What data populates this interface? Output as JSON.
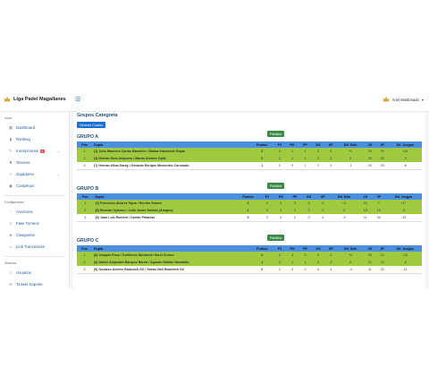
{
  "brand": {
    "name": "Liga Padel Magallanes"
  },
  "user": {
    "name": "Ariel Maldonado"
  },
  "sidebar": {
    "sections": [
      {
        "title": "Inicio",
        "items": [
          {
            "label": "Dashboard",
            "icon": "dashboard-icon"
          },
          {
            "label": "Ranking",
            "icon": "ranking-icon"
          },
          {
            "label": "Inscripciones",
            "icon": "inscriptions-icon",
            "badge": "4",
            "expand": true
          },
          {
            "label": "Torneos",
            "icon": "trophy-icon"
          },
          {
            "label": "Jugadores",
            "icon": "users-icon",
            "expand": true
          },
          {
            "label": "Complejos",
            "icon": "building-icon"
          }
        ]
      },
      {
        "title": "Configuración",
        "items": [
          {
            "label": "Ascensos",
            "icon": "arrow-up-icon"
          },
          {
            "label": "Fase Torneos",
            "icon": "phases-icon"
          },
          {
            "label": "Categorias",
            "icon": "tags-icon"
          },
          {
            "label": "Link Transmisión",
            "icon": "link-icon"
          }
        ]
      },
      {
        "title": "Sistema",
        "items": [
          {
            "label": "Usuarios",
            "icon": "user-icon"
          },
          {
            "label": "Tickets Soporte",
            "icon": "ticket-icon"
          }
        ]
      }
    ]
  },
  "page": {
    "title": "Grupos Categoria",
    "generate_button": "Generar Cuadro"
  },
  "table_headers": [
    "Pos",
    "Dupla",
    "Puntos",
    "PJ",
    "PG",
    "PP",
    "SG",
    "SP",
    "Dif. Sets",
    "JG",
    "JP",
    "Dif. Juegos"
  ],
  "groups": [
    {
      "name": "GRUPO A",
      "button": "Partidos",
      "rows": [
        {
          "pos": "1",
          "dupla": "(1) John Mauricio Carlos Manolich / Matias Kambonic Rojas",
          "puntos": "3",
          "pj": "2",
          "pg": "1",
          "pp": "1",
          "sg": "3",
          "sp": "2",
          "ds": "+1",
          "jg": "29",
          "jp": "19",
          "dj": "+10",
          "qualified": true
        },
        {
          "pos": "2",
          "dupla": "(4) Hernan Soto Ampuero / Martin Alvarez Opitz",
          "puntos": "3",
          "pj": "2",
          "pg": "1",
          "pp": "1",
          "sg": "3",
          "sp": "3",
          "ds": "0",
          "jg": "23",
          "jp": "25",
          "dj": "-2",
          "qualified": true
        },
        {
          "pos": "3",
          "dupla": "(7) Hernan Ulloa Garay / Gerardo Enrique Menendez Coronado",
          "puntos": "1",
          "pj": "2",
          "pg": "0",
          "pp": "1",
          "sg": "2",
          "sp": "3",
          "ds": "-1",
          "jg": "23",
          "jp": "29",
          "dj": "-6",
          "qualified": false
        }
      ]
    },
    {
      "name": "GRUPO B",
      "button": "Partidos",
      "rows": [
        {
          "pos": "1",
          "dupla": "(2) Francisco Alvarez Tapia / Hernán Gomez",
          "puntos": "2",
          "pj": "2",
          "pg": "2",
          "pp": "0",
          "sg": "4",
          "sp": "0",
          "ds": "+4",
          "jg": "24",
          "jp": "7",
          "dj": "+17",
          "qualified": true
        },
        {
          "pos": "2",
          "dupla": "(8) Ricardo Oyarzun / Julio Javier Salinas (Amigos)",
          "puntos": "1",
          "pj": "2",
          "pg": "1",
          "pp": "1",
          "sg": "2",
          "sp": "2",
          "ds": "0",
          "jg": "15",
          "jp": "19",
          "dj": "-4",
          "qualified": true
        },
        {
          "pos": "3",
          "dupla": "(5) Juan Luis Romero / Dorian Palacios",
          "puntos": "0",
          "pj": "2",
          "pg": "0",
          "pp": "2",
          "sg": "0",
          "sp": "4",
          "ds": "-4",
          "jg": "11",
          "jp": "24",
          "dj": "-13",
          "qualified": false
        }
      ]
    },
    {
      "name": "GRUPO C",
      "button": "Partidos",
      "rows": [
        {
          "pos": "1",
          "dupla": "(6) Joaquin Rosa / Guillermo Alexander Nicol Gomez",
          "puntos": "2",
          "pj": "2",
          "pg": "2",
          "pp": "0",
          "sg": "4",
          "sp": "0",
          "ds": "+4",
          "jg": "25",
          "jp": "12",
          "dj": "+13",
          "qualified": true
        },
        {
          "pos": "2",
          "dupla": "(3) Daniel Alejandro Barquez Barria / Agustin Roldan Montaldo",
          "puntos": "1",
          "pj": "2",
          "pg": "1",
          "pp": "1",
          "sg": "2",
          "sp": "2",
          "ds": "0",
          "jg": "21",
          "jp": "23",
          "dj": "-2",
          "qualified": true
        },
        {
          "pos": "3",
          "dupla": "(9) Gustavo Andrés Radovich Gil / Tomas Neil Radovich Gil",
          "puntos": "0",
          "pj": "2",
          "pg": "0",
          "pp": "2",
          "sg": "0",
          "sp": "4",
          "ds": "-4",
          "jg": "11",
          "jp": "22",
          "dj": "-11",
          "qualified": false
        }
      ]
    }
  ]
}
